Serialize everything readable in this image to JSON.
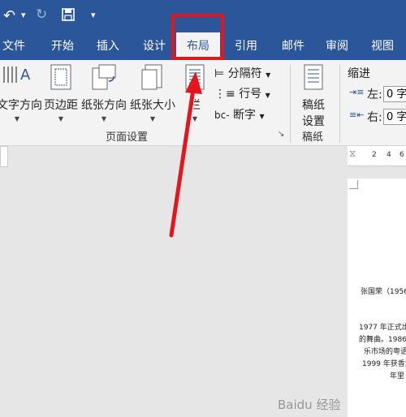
{
  "quick_access": {
    "undo_icon": "↶",
    "dropdown": "▾",
    "redo_icon": "↻",
    "save_icon": "save",
    "customize": "▾"
  },
  "tabs": [
    {
      "label": "文件"
    },
    {
      "label": "开始"
    },
    {
      "label": "插入"
    },
    {
      "label": "设计"
    },
    {
      "label": "布局"
    },
    {
      "label": "引用"
    },
    {
      "label": "邮件"
    },
    {
      "label": "审阅"
    },
    {
      "label": "视图"
    }
  ],
  "ribbon": {
    "text_direction": "文字方向",
    "margins": "页边距",
    "orientation": "纸张方向",
    "size": "纸张大小",
    "columns": "栏",
    "breaks": "分隔符",
    "line_numbers": "行号",
    "hyphenation": "断字",
    "page_setup_group": "页面设置",
    "draft_settings": "稿纸设置",
    "draft_settings_line1": "稿纸",
    "draft_settings_line2": "设置",
    "draft_group": "稿纸",
    "indent_title": "缩进",
    "indent_left_label": "左:",
    "indent_right_label": "右:",
    "indent_left_value": "0 字",
    "indent_right_value": "0 字"
  },
  "ruler": {
    "ticks": [
      "2",
      "4",
      "6"
    ]
  },
  "document": {
    "lines": [
      "张国荣（1956",
      "1977 年正式出",
      "的舞曲。1986",
      "乐市场的粤语",
      "1999 年获香港",
      "年里"
    ]
  },
  "watermark": "Baidu 经验",
  "colors": {
    "title_bar": "#2b579a",
    "highlight": "#e4151c"
  }
}
